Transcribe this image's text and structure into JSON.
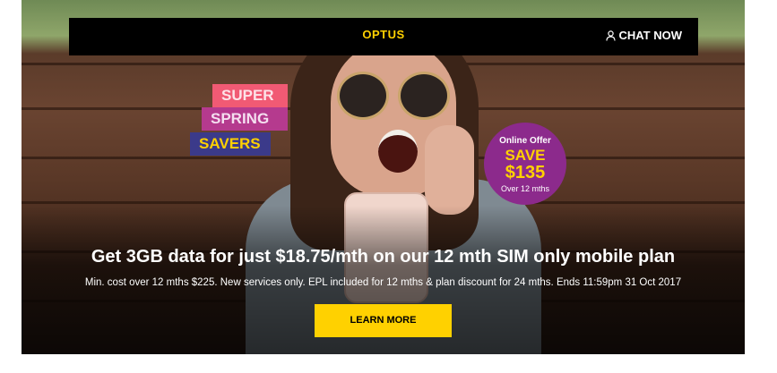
{
  "header": {
    "logo": "OPTUS",
    "chat_label": "CHAT NOW"
  },
  "promo_tags": [
    "SUPER",
    "SPRING",
    "SAVERS"
  ],
  "offer": {
    "line1": "Online Offer",
    "line2": "SAVE",
    "line3": "$135",
    "line4": "Over 12 mths"
  },
  "hero": {
    "headline": "Get 3GB data for just $18.75/mth on our 12 mth SIM only mobile plan",
    "subtext": "Min. cost over 12 mths $225. New services only. EPL included for 12 mths & plan discount for 24 mths. Ends 11:59pm 31 Oct 2017",
    "cta_label": "LEARN MORE"
  },
  "colors": {
    "brand_yellow": "#ffd100",
    "offer_purple": "#8c2a8c",
    "bar_black": "#000000"
  }
}
